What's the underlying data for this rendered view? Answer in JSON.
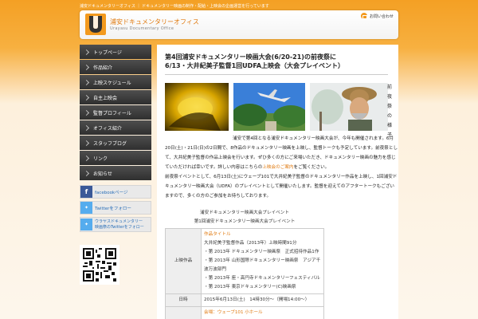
{
  "top_banner": "浦安ドキュメンタリーオフィス ｜ ドキュメンタリー映画の制作・配給・上映会の企画運営を行っています",
  "header": {
    "title": "浦安ドキュメンタリーオフィス",
    "subtitle": "Urayasu Documentary Office",
    "contact_label": "お問い合わせ"
  },
  "sidebar": {
    "items": [
      {
        "label": "トップページ"
      },
      {
        "label": "作品紹介"
      },
      {
        "label": "上映スケジュール"
      },
      {
        "label": "自主上映会"
      },
      {
        "label": "監督プロフィール"
      },
      {
        "label": "オフィス紹介"
      },
      {
        "label": "スタッフブログ"
      },
      {
        "label": "リンク"
      },
      {
        "label": "お知らせ"
      }
    ],
    "facebook_label": "facebookページ",
    "twitter_label": "Twitterをフォロー",
    "twitter2_line1": "ウラヤスドキュメンタリー",
    "twitter2_line2": "映画祭のTwitterをフォロー"
  },
  "post": {
    "title_line1": "第4回浦安ドキュメンタリー映画大会(6/20-21)の前夜祭に",
    "title_line2": "6/13・大井紀美子監督1回UDFA上映会（大会プレイベント）",
    "vertical_caption": "前夜祭の様子",
    "p1": "浦安で第4回となる浦安ドキュメンタリー映画大会が、今年も開催されます。6月20日(土)・21日(日)の2日間で、8作品のドキュメンタリー映画を上映し、監督トークも予定しています。前夜祭として、大井紀美子監督の作品上映会を行います。ぜひ多くの方にご来場いただき、ドキュメンタリー映画の魅力を感じていただければ幸いです。詳しい内容はこちらの",
    "p1_link": "上映会のご案内",
    "p1_tail": "をご覧ください。",
    "p2": "前夜祭イベントとして、6月13日(土)にウェーブ101で大井紀美子監督のドキュメンタリー作品を上映し、1回浦安ドキュメンタリー映画大会（UDFA）のプレイベントとして開催いたします。監督を迎えてのアフタートークもございますので、多くの方のご参加をお待ちしております。",
    "center1": "浦安ドキュメンタリー映画大会プレイベント",
    "center2": "第1回浦安ドキュメンタリー映画大会プレイベント",
    "table": [
      {
        "label": "上映作品",
        "link": "作品タイトル",
        "lines": [
          "大井紀美子監督作品（2013年）上映時間91分",
          "・第 2013年 ドキュメンタリー映画祭　正式招待作品1作",
          "・第 2013年 山形国際ドキュメンタリー映画祭　アジア千波万波部門",
          "・第 2013年 座・高円寺ドキュメンタリーフェスティバル",
          "・第 2013年 東京ドキュメンタリー(C)映画祭"
        ]
      },
      {
        "label": "日時",
        "lines": [
          "2015年6月13日(土)　14時30分〜（開場14:00〜）"
        ]
      },
      {
        "label": "",
        "link": "会場：ウェーブ101 小ホール",
        "lines": []
      }
    ]
  }
}
